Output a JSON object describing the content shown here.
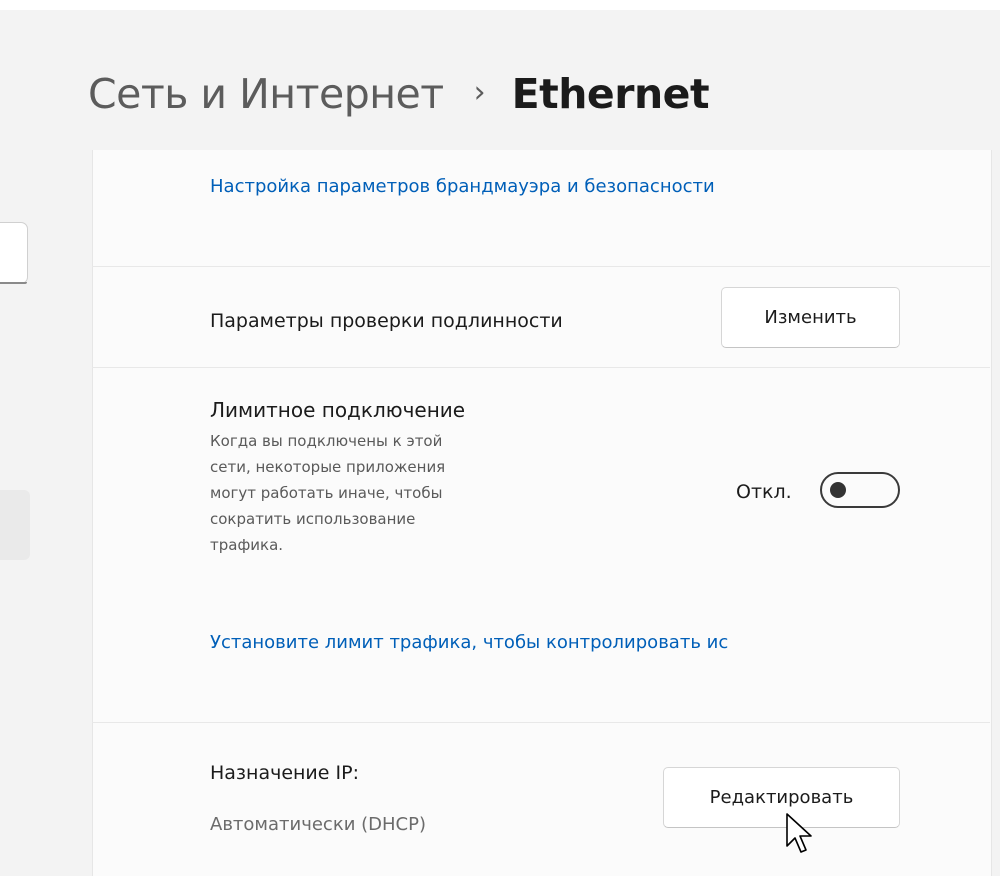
{
  "breadcrumb": {
    "parent": "Сеть и Интернет",
    "separator": "›",
    "current": "Ethernet"
  },
  "firewall_link": "Настройка параметров брандмауэра и безопасности",
  "auth": {
    "label": "Параметры проверки подлинности",
    "button": "Изменить"
  },
  "metered": {
    "title": "Лимитное подключение",
    "description_lines": [
      "Когда вы подключены к этой",
      "сети, некоторые приложения",
      "могут работать иначе, чтобы",
      "сократить использование",
      "трафика."
    ],
    "toggle_state": "Откл.",
    "toggle_on": false,
    "limit_link": "Установите лимит трафика, чтобы контролировать ис"
  },
  "ip": {
    "label": "Назначение IP:",
    "value": "Автоматически (DHCP)",
    "button": "Редактировать"
  },
  "colors": {
    "accent_link": "#005fb8",
    "background": "#f3f3f3",
    "card": "#fbfbfb"
  }
}
